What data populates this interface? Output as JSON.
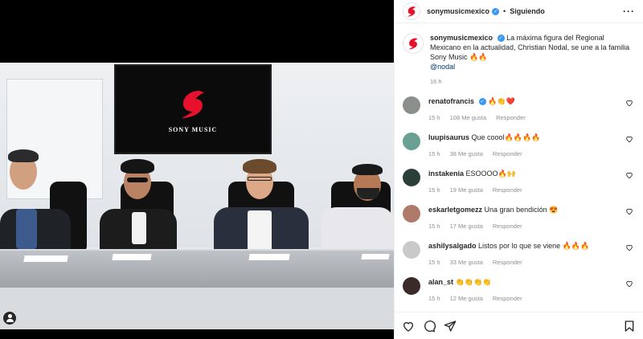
{
  "account": {
    "username": "sonymusicmexico",
    "follow_status": "Siguiendo",
    "verified": true
  },
  "post": {
    "caption_prefix": "La máxima figura del Regional Mexicano en la actualidad, Christian Nodal, se une a la familia Sony Music ",
    "caption_emoji": "🔥🔥",
    "mention": "@nodal",
    "time": "16 h",
    "media": {
      "tv_brand": "SONY MUSIC"
    }
  },
  "comments": [
    {
      "user": "renatofrancis",
      "verified": true,
      "text": "🔥👏❤️",
      "time": "15 h",
      "likes": "108 Me gusta",
      "reply": "Responder",
      "avatar_color": "#8a8f8c"
    },
    {
      "user": "luupisaurus",
      "verified": false,
      "text": "Que coool🔥🔥🔥🔥",
      "time": "15 h",
      "likes": "38 Me gusta",
      "reply": "Responder",
      "avatar_color": "#6a9f94"
    },
    {
      "user": "instakenia",
      "verified": false,
      "text": "ESOOOO🔥🙌",
      "time": "15 h",
      "likes": "19 Me gusta",
      "reply": "Responder",
      "avatar_color": "#2c3e3a"
    },
    {
      "user": "eskarletgomezz",
      "verified": false,
      "text": "Una gran bendición 😍",
      "time": "15 h",
      "likes": "17 Me gusta",
      "reply": "Responder",
      "avatar_color": "#b07a6a"
    },
    {
      "user": "ashilysalgado",
      "verified": false,
      "text": "Listos por lo que se viene 🔥🔥🔥",
      "time": "15 h",
      "likes": "33 Me gusta",
      "reply": "Responder",
      "avatar_color": "#c9c9c9"
    },
    {
      "user": "alan_st",
      "verified": false,
      "text": "👏👏👏👏",
      "time": "15 h",
      "likes": "12 Me gusta",
      "reply": "Responder",
      "avatar_color": "#3a2a2a"
    }
  ],
  "colors": {
    "accent": "#3897f0",
    "sony_red": "#e8112d",
    "muted": "#8e8e8e"
  },
  "icons": {
    "more": "more-icon",
    "like": "heart-icon",
    "comment": "comment-icon",
    "share": "share-icon",
    "save": "bookmark-icon"
  }
}
